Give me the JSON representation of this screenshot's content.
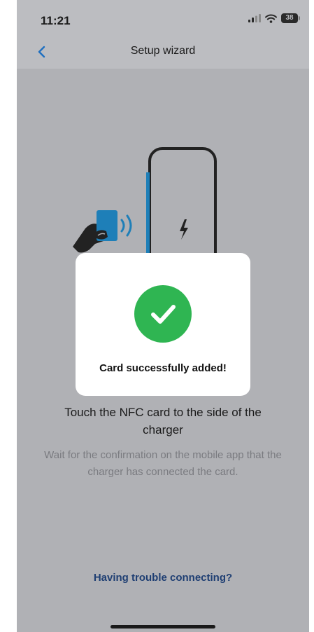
{
  "status_bar": {
    "time": "11:21",
    "battery": "38"
  },
  "nav": {
    "title": "Setup wizard"
  },
  "content": {
    "heading": "Touch the NFC card to the side of the charger",
    "subtext": "Wait for the confirmation on the mobile app that the charger has connected the card.",
    "trouble_link": "Having trouble connecting?"
  },
  "dialog": {
    "message": "Card successfully added!",
    "icon": "check-circle-icon"
  },
  "colors": {
    "overlay_background": "#b0b1b5",
    "success_green": "#2fb552",
    "link_blue": "#1f3f73",
    "accent_blue": "#1e7fb8"
  }
}
